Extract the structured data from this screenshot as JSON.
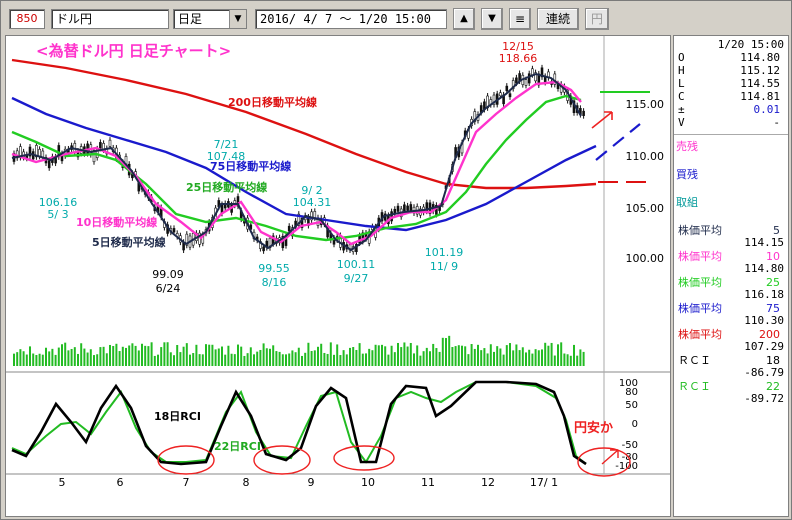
{
  "toolbar": {
    "code": "850",
    "name": "ドル円",
    "period": "日足",
    "range": "2016/ 4/ 7 ～  1/20 15:00",
    "up_glyph": "▲",
    "down_glyph": "▼",
    "menu_glyph": "≡",
    "continuous_label": "連続",
    "yen_label": "円"
  },
  "chart_title": "<為替ドル円 日足チャート>",
  "colors": {
    "candles": "#111111",
    "ma5": "#1e2a4a",
    "ma10": "#ff33cc",
    "ma25": "#22cc22",
    "ma75": "#1a1acc",
    "ma200": "#dd1111",
    "volume": "#22bb22",
    "rci18": "#000000",
    "rci22": "#22bb22",
    "annotation_circle": "#ee2222"
  },
  "price_axis": {
    "ticks": [
      "115.00",
      "110.00",
      "105.00",
      "100.00"
    ]
  },
  "rci_axis": {
    "ticks": [
      "100",
      "80",
      "50",
      "0",
      "-50",
      "-80",
      "-100"
    ]
  },
  "x_axis": {
    "ticks": [
      "5",
      "6",
      "7",
      "8",
      "9",
      "10",
      "11",
      "12",
      "17/ 1"
    ]
  },
  "labels": {
    "ma200": "200日移動平均線",
    "ma75": "75日移動平均線",
    "ma25": "25日移動平均線",
    "ma10": "10日移動平均線",
    "ma5": "5日移動平均線",
    "rci18": "18日RCI",
    "rci22": "22日RCI",
    "yen_weak": "円安か"
  },
  "price_annotations": {
    "high_date": "12/15",
    "high_value": "118.66",
    "p1_value": "106.16",
    "p1_date": "5/ 3",
    "p2_value": "99.09",
    "p2_date": "6/24",
    "p3_date": "7/21",
    "p3_value": "107.48",
    "p4_value": "99.55",
    "p4_date": "8/16",
    "p5_date": "9/ 2",
    "p5_value": "104.31",
    "p6_value": "100.11",
    "p6_date": "9/27",
    "p7_value": "101.19",
    "p7_date": "11/ 9"
  },
  "info_panel": {
    "date": "1/20 15:00",
    "ohlc": [
      {
        "k": "O",
        "v": "114.80"
      },
      {
        "k": "H",
        "v": "115.12"
      },
      {
        "k": "L",
        "v": "114.55"
      },
      {
        "k": "C",
        "v": "114.81"
      },
      {
        "k": "±",
        "v": "0.01"
      },
      {
        "k": "V",
        "v": "-"
      }
    ],
    "sell_balance": "売残",
    "buy_balance": "買残",
    "trade_group": "取組",
    "ma": [
      {
        "label": "株価平均",
        "period": "5",
        "value": "114.15",
        "color": "#1e2a4a"
      },
      {
        "label": "株価平均",
        "period": "10",
        "value": "114.80",
        "color": "#ff33cc"
      },
      {
        "label": "株価平均",
        "period": "25",
        "value": "116.18",
        "color": "#22cc22"
      },
      {
        "label": "株価平均",
        "period": "75",
        "value": "110.30",
        "color": "#1a1acc"
      },
      {
        "label": "株価平均",
        "period": "200",
        "value": "107.29",
        "color": "#dd1111"
      }
    ],
    "rci": [
      {
        "label": "ＲＣＩ",
        "period": "18",
        "value": "-86.79",
        "color": "#000000"
      },
      {
        "label": "ＲＣＩ",
        "period": "22",
        "value": "-89.72",
        "color": "#22bb22"
      }
    ]
  }
}
